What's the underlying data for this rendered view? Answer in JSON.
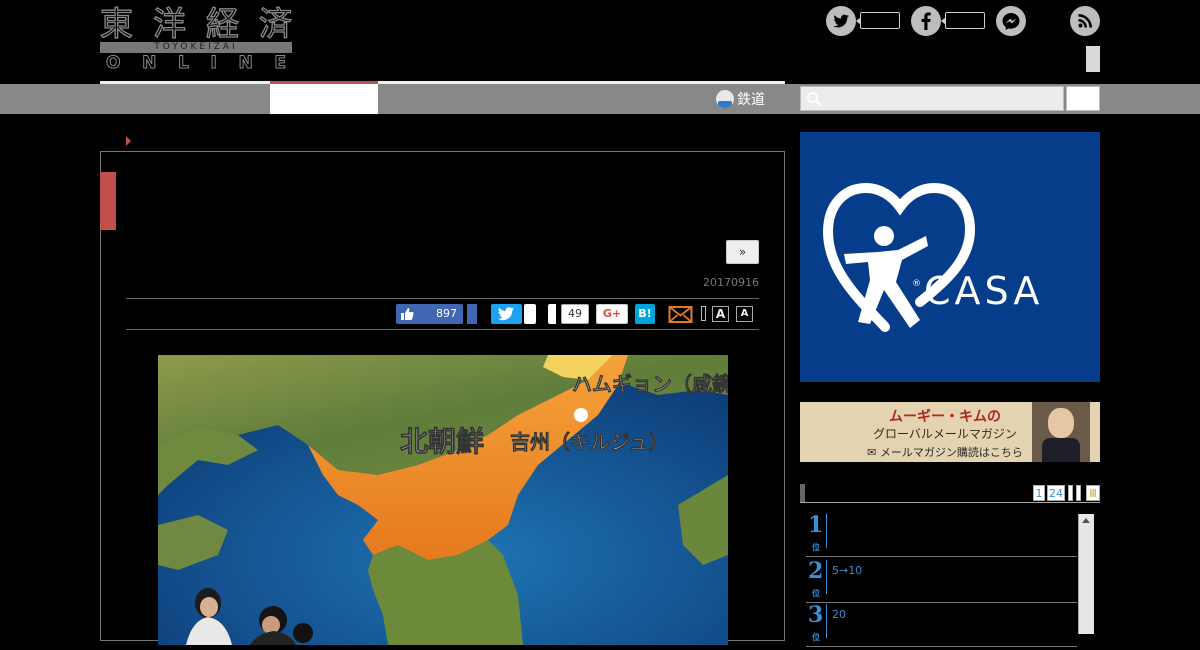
{
  "site": {
    "logo_kanji": [
      "東",
      "洋",
      "経",
      "済"
    ],
    "logo_sub": "TOYOKEIZAI",
    "logo_online": [
      "O",
      "N",
      "L",
      "I",
      "N",
      "E"
    ]
  },
  "nav": {
    "railway_label": "鉄道"
  },
  "article": {
    "next_label": "»",
    "date": "20170916",
    "share": {
      "fb_like_count": "897",
      "hatena_count": "49",
      "gplus_label": "G+",
      "hatebu_label": "B!",
      "font_large": "A",
      "font_small": "A"
    },
    "photo_labels": {
      "hamgyong": "ハムギョン（咸鏡）",
      "north_korea": "北朝鮮",
      "kilju": "吉州（キルジュ）"
    }
  },
  "sidebar": {
    "ad_brand": "CASA",
    "ad_registered": "®",
    "banner_line1": "ムーギー・キムの",
    "banner_line2": "グローバルメールマガジン",
    "banner_line3": "メールマガジン購読はこちら",
    "ranking_tabs": [
      "1",
      "24"
    ],
    "ranking": [
      {
        "rank": "1",
        "suffix": "位",
        "text": ""
      },
      {
        "rank": "2",
        "suffix": "位",
        "text": "5→10"
      },
      {
        "rank": "3",
        "suffix": "位",
        "text": "20"
      }
    ]
  }
}
